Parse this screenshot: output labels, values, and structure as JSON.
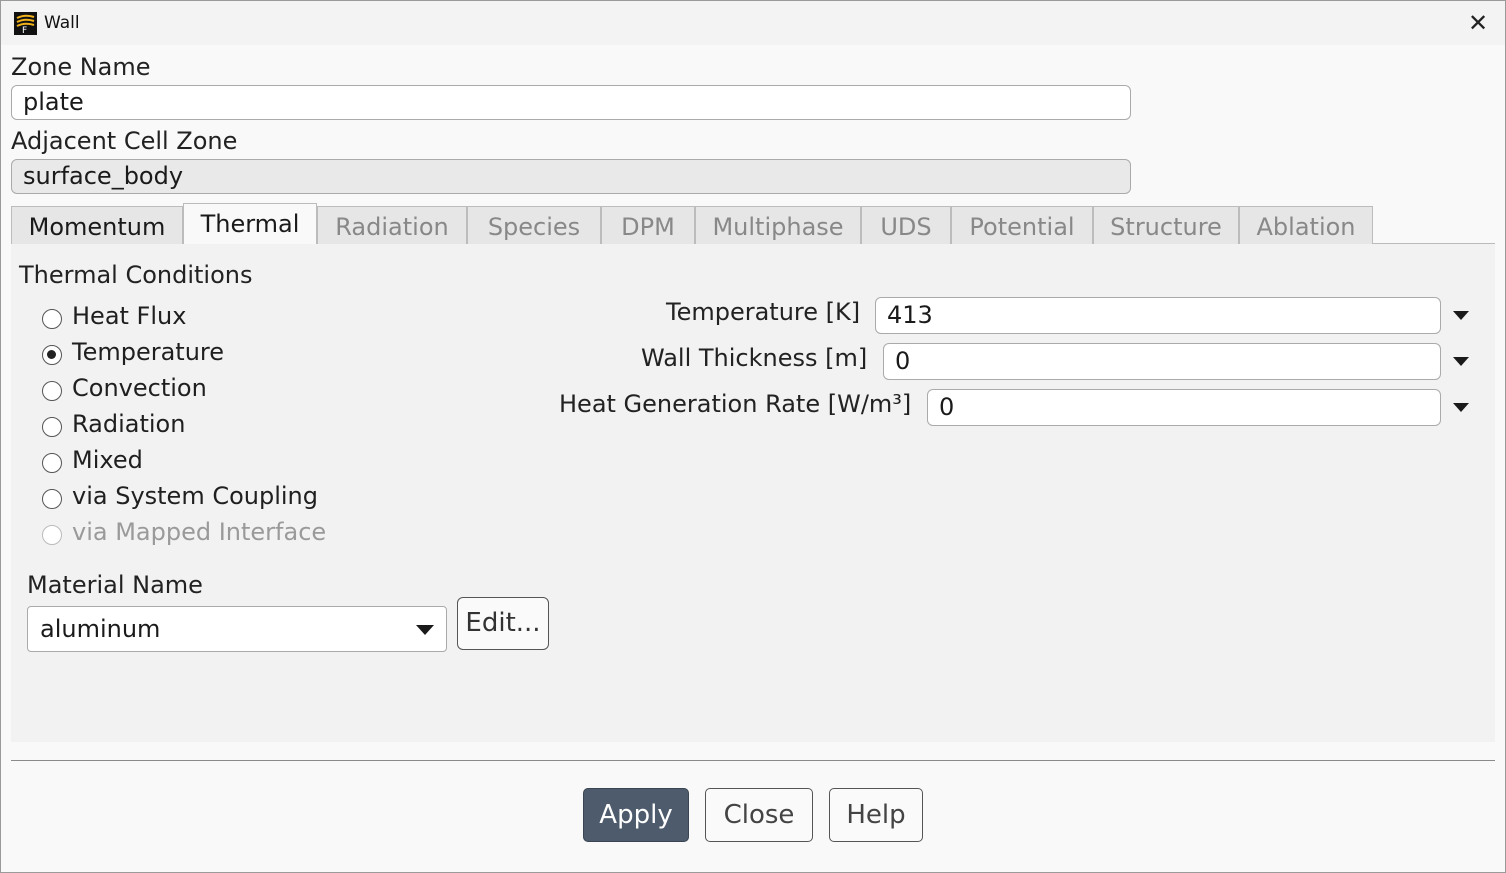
{
  "window": {
    "title": "Wall"
  },
  "zone_name": {
    "label": "Zone Name",
    "value": "plate"
  },
  "adjacent_cell_zone": {
    "label": "Adjacent Cell Zone",
    "value": "surface_body"
  },
  "tabs": [
    {
      "label": "Momentum",
      "state": "enabled"
    },
    {
      "label": "Thermal",
      "state": "active"
    },
    {
      "label": "Radiation",
      "state": "disabled"
    },
    {
      "label": "Species",
      "state": "disabled"
    },
    {
      "label": "DPM",
      "state": "disabled"
    },
    {
      "label": "Multiphase",
      "state": "disabled"
    },
    {
      "label": "UDS",
      "state": "disabled"
    },
    {
      "label": "Potential",
      "state": "disabled"
    },
    {
      "label": "Structure",
      "state": "disabled"
    },
    {
      "label": "Ablation",
      "state": "disabled"
    }
  ],
  "thermal": {
    "section_title": "Thermal Conditions",
    "conditions": [
      {
        "label": "Heat Flux",
        "checked": false,
        "disabled": false
      },
      {
        "label": "Temperature",
        "checked": true,
        "disabled": false
      },
      {
        "label": "Convection",
        "checked": false,
        "disabled": false
      },
      {
        "label": "Radiation",
        "checked": false,
        "disabled": false
      },
      {
        "label": "Mixed",
        "checked": false,
        "disabled": false
      },
      {
        "label": "via System Coupling",
        "checked": false,
        "disabled": false
      },
      {
        "label": "via Mapped Interface",
        "checked": false,
        "disabled": true
      }
    ],
    "fields": [
      {
        "label": "Temperature [K]",
        "value": "413"
      },
      {
        "label": "Wall Thickness [m]",
        "value": "0"
      },
      {
        "label": "Heat Generation Rate [W/m³]",
        "value": "0"
      }
    ],
    "material": {
      "label": "Material Name",
      "value": "aluminum",
      "edit_label": "Edit..."
    }
  },
  "footer": {
    "apply": "Apply",
    "close": "Close",
    "help": "Help"
  }
}
